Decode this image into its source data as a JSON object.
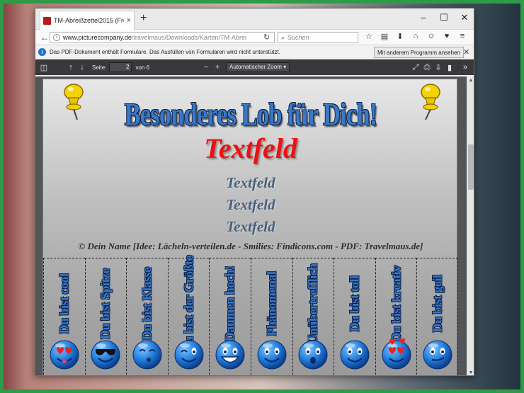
{
  "browser": {
    "tab_title": "TM-Abreißzettel2015 (Free...",
    "tab_close": "×",
    "new_tab": "+",
    "url_host": "www.picturecompany.de",
    "url_path": "/travelmaus/Downloads/Karten/TM-Abrei",
    "search_placeholder": "Suchen",
    "window_controls": [
      "–",
      "☐",
      "✕"
    ],
    "toolbar_icons": [
      "star-icon",
      "clipboard-icon",
      "download-icon",
      "home-icon",
      "face-icon",
      "pocket-icon",
      "menu-icon"
    ]
  },
  "notification": {
    "message": "Das PDF-Dokument enthält Formulare. Das Ausfüllen von Formularen wird nicht unterstützt.",
    "button": "Mit anderem Programm ansehen",
    "close": "✕"
  },
  "pdf_toolbar": {
    "page_label": "Seite:",
    "page_value": "2",
    "page_total": "von 6",
    "zoom_minus": "−",
    "zoom_plus": "+",
    "zoom_value": "Automatischer Zoom"
  },
  "document": {
    "title": "Besonderes Lob  für Dich!",
    "main_field": "Textfeld",
    "sub_fields": [
      "Textfeld",
      "Textfeld",
      "Textfeld"
    ],
    "credit": "© Dein Name [Idee: Lächeln-verteilen.de - Smilies: Findicons.com - PDF: Travelmaus.de]",
    "strips": [
      {
        "label": "Du bist cool",
        "smiley": "cool-kiss"
      },
      {
        "label": "Du bist Spitze",
        "smiley": "sunglasses"
      },
      {
        "label": "Du bist Klasse",
        "smiley": "kiss"
      },
      {
        "label": "Du bist der Größte",
        "smiley": "wink"
      },
      {
        "label": "Daumen hoch!",
        "smiley": "grin"
      },
      {
        "label": "Phänomenal",
        "smiley": "happy"
      },
      {
        "label": "Unübertrefflich",
        "smiley": "surprised"
      },
      {
        "label": "Du bist toll",
        "smiley": "smile"
      },
      {
        "label": "Du bist kreativ",
        "smiley": "heart-eyes"
      },
      {
        "label": "Du bist geil",
        "smiley": "sly"
      }
    ]
  },
  "colors": {
    "frame": "#2d9b48",
    "title_blue": "#3a78c7",
    "field_red": "#ee1111",
    "sub_field": "#4a5f7e"
  }
}
